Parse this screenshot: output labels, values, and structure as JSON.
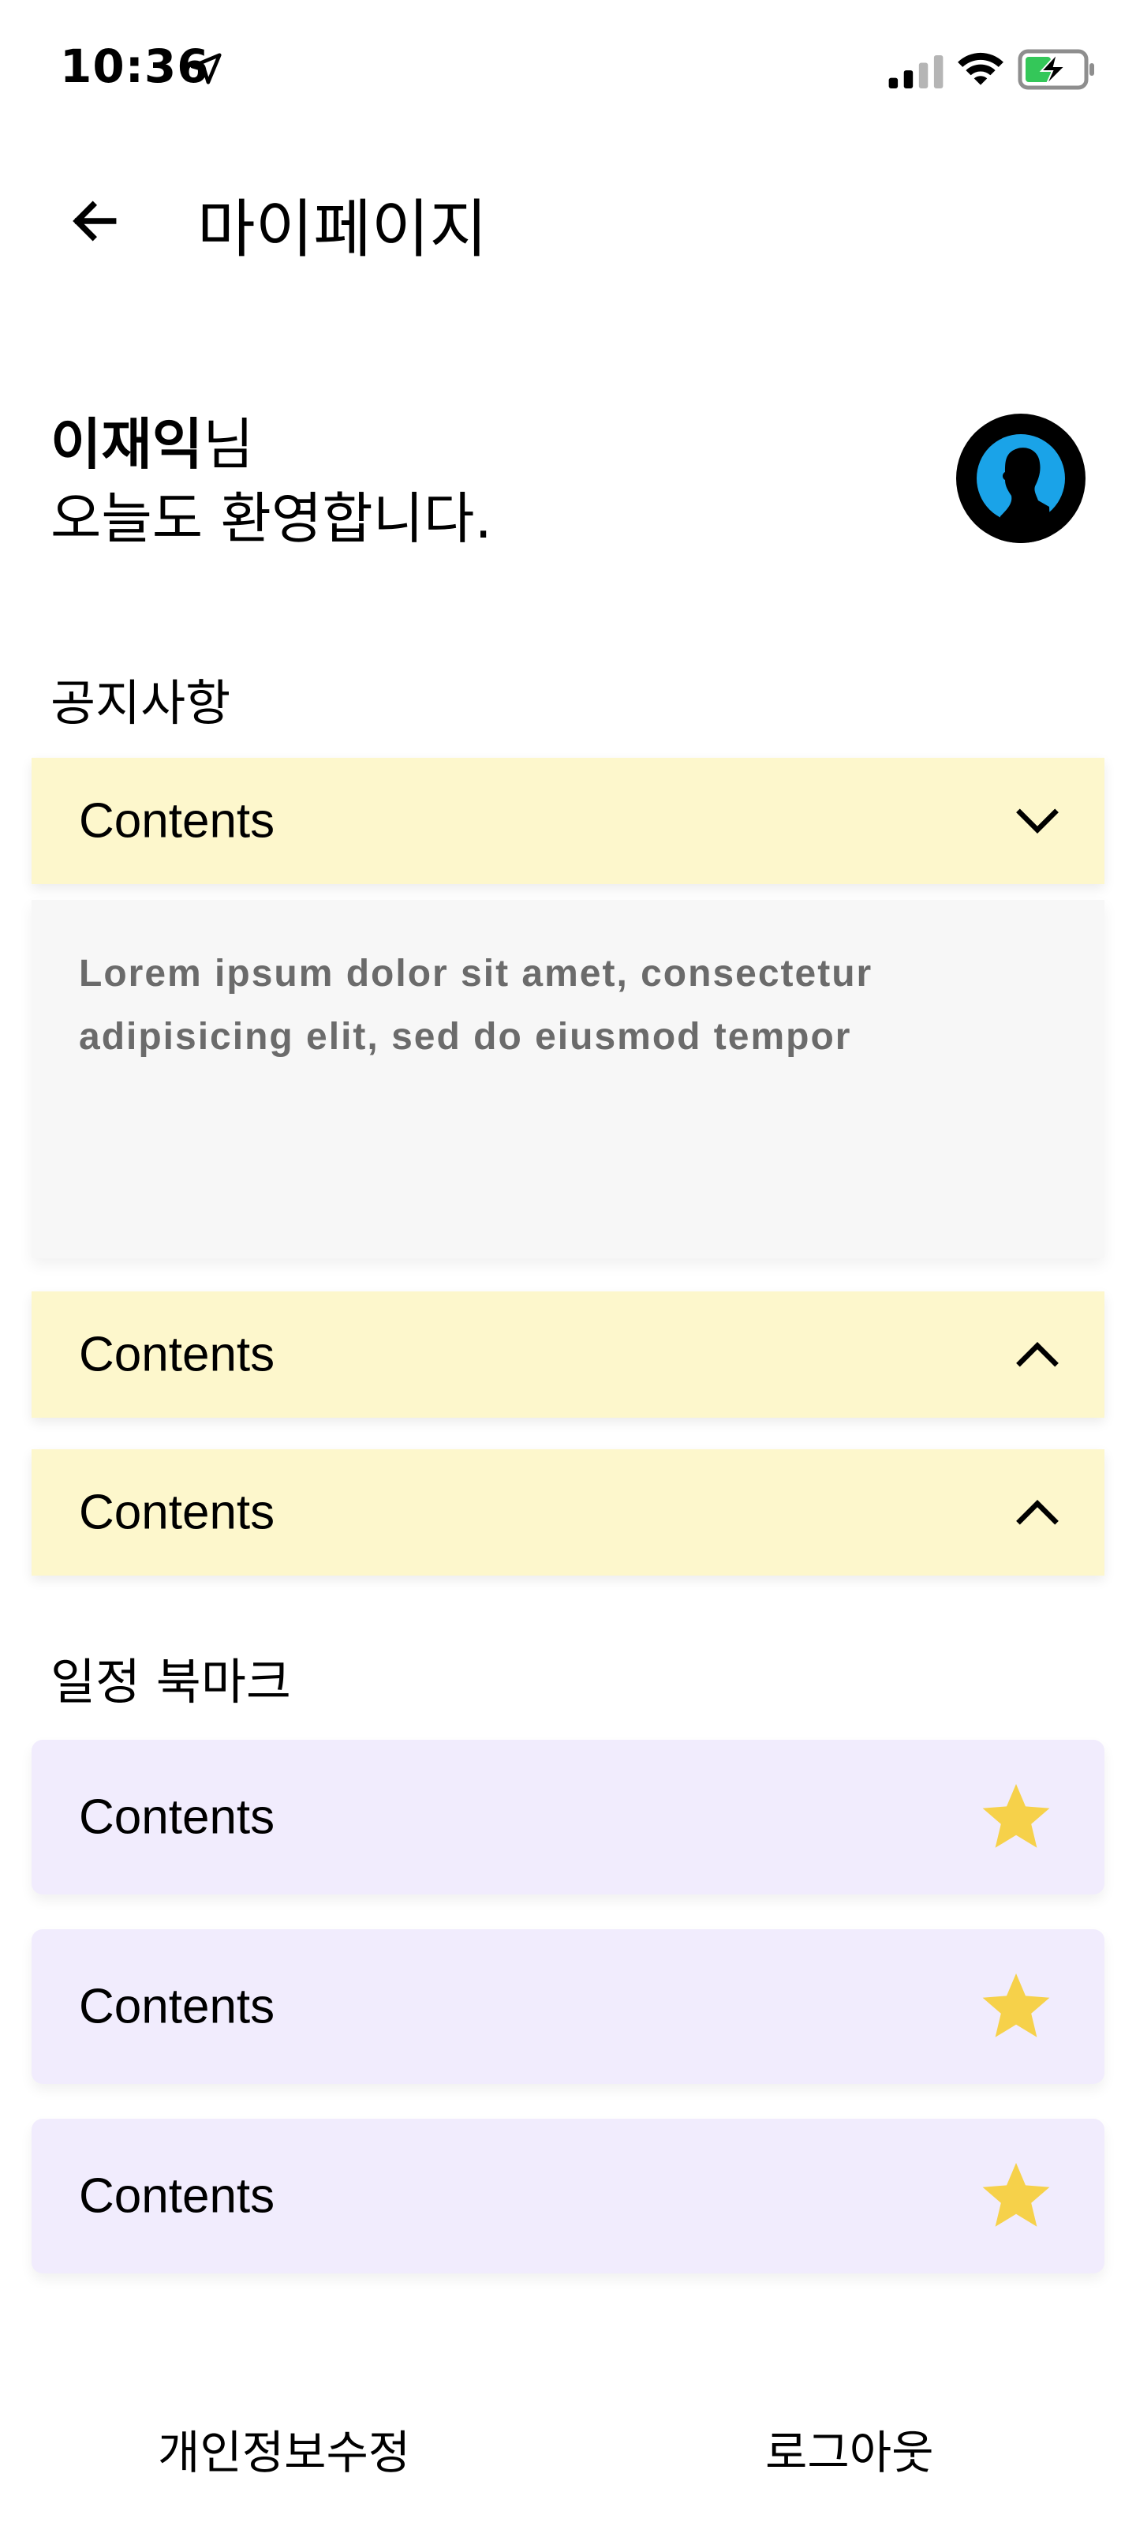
{
  "status_bar": {
    "time": "10:36",
    "icons": [
      "location-arrow-icon",
      "cellular-signal-icon",
      "wifi-icon",
      "battery-charging-icon"
    ]
  },
  "header": {
    "back_icon": "arrow-left-icon",
    "title": "마이페이지"
  },
  "greeting": {
    "user_name": "이재익",
    "suffix": "님",
    "line2": "오늘도 환영합니다."
  },
  "notices": {
    "title": "공지사항",
    "items": [
      {
        "label": "Contents",
        "expanded": true,
        "body": "Lorem ipsum dolor sit amet, consectetur adipisicing elit, sed do eiusmod tempor",
        "chevron": "chevron-down-icon"
      },
      {
        "label": "Contents",
        "expanded": false,
        "chevron": "chevron-up-icon"
      },
      {
        "label": "Contents",
        "expanded": false,
        "chevron": "chevron-up-icon"
      }
    ]
  },
  "bookmarks": {
    "title": "일정 북마크",
    "items": [
      {
        "label": "Contents",
        "icon": "star-icon"
      },
      {
        "label": "Contents",
        "icon": "star-icon"
      },
      {
        "label": "Contents",
        "icon": "star-icon"
      }
    ]
  },
  "footer": {
    "edit_profile": "개인정보수정",
    "logout": "로그아웃"
  },
  "colors": {
    "notice_bg": "#fdf7cc",
    "bookmark_bg": "#f1ecfd",
    "star": "#f6d14a",
    "avatar_accent": "#1aa3e8"
  }
}
